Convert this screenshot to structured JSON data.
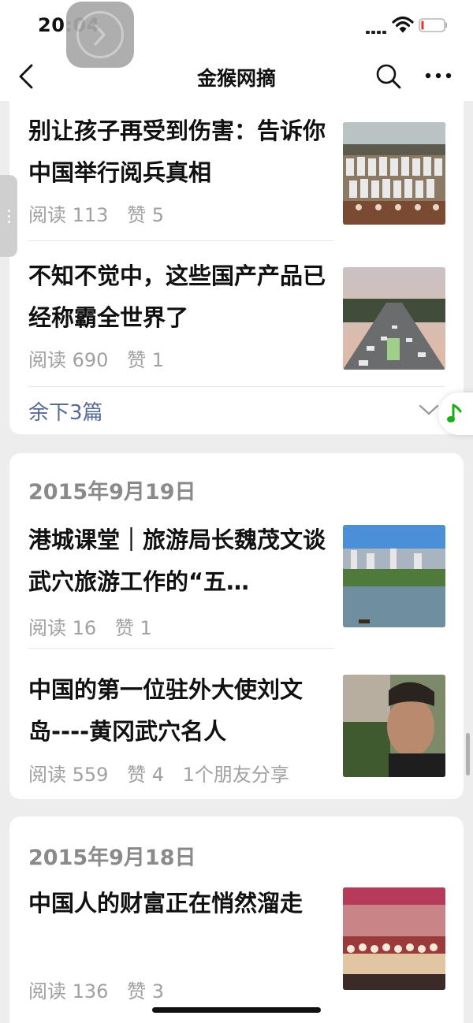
{
  "status_bar": {
    "time": "20:04"
  },
  "nav": {
    "title": "金猴网摘"
  },
  "group0": {
    "articles": [
      {
        "title": "别让孩子再受到伤害：告诉你中国举行阅兵真相",
        "reads": "阅读 113",
        "likes": "赞 5",
        "extra": ""
      },
      {
        "title": "不知不觉中，这些国产产品已经称霸全世界了",
        "reads": "阅读 690",
        "likes": "赞 1",
        "extra": ""
      }
    ],
    "more_label": "余下3篇"
  },
  "group1": {
    "date": "2015年9月19日",
    "articles": [
      {
        "title": "港城课堂｜旅游局长魏茂文谈武穴旅游工作的“五…",
        "reads": "阅读 16",
        "likes": "赞 1",
        "extra": ""
      },
      {
        "title": "中国的第一位驻外大使刘文岛----黄冈武穴名人",
        "reads": "阅读 559",
        "likes": "赞 4",
        "extra": "1个朋友分享"
      }
    ]
  },
  "group2": {
    "date": "2015年9月18日",
    "articles": [
      {
        "title": "中国人的财富正在悄然溜走",
        "reads": "阅读 136",
        "likes": "赞 3",
        "extra": ""
      }
    ]
  },
  "icons": {
    "back": "chevron-left-icon",
    "search": "search-icon",
    "more": "more-icon",
    "music": "music-note-icon"
  },
  "colors": {
    "link": "#576b95",
    "meta": "#a0a0a0",
    "date": "#8a8a8a",
    "music": "#1aad19"
  }
}
